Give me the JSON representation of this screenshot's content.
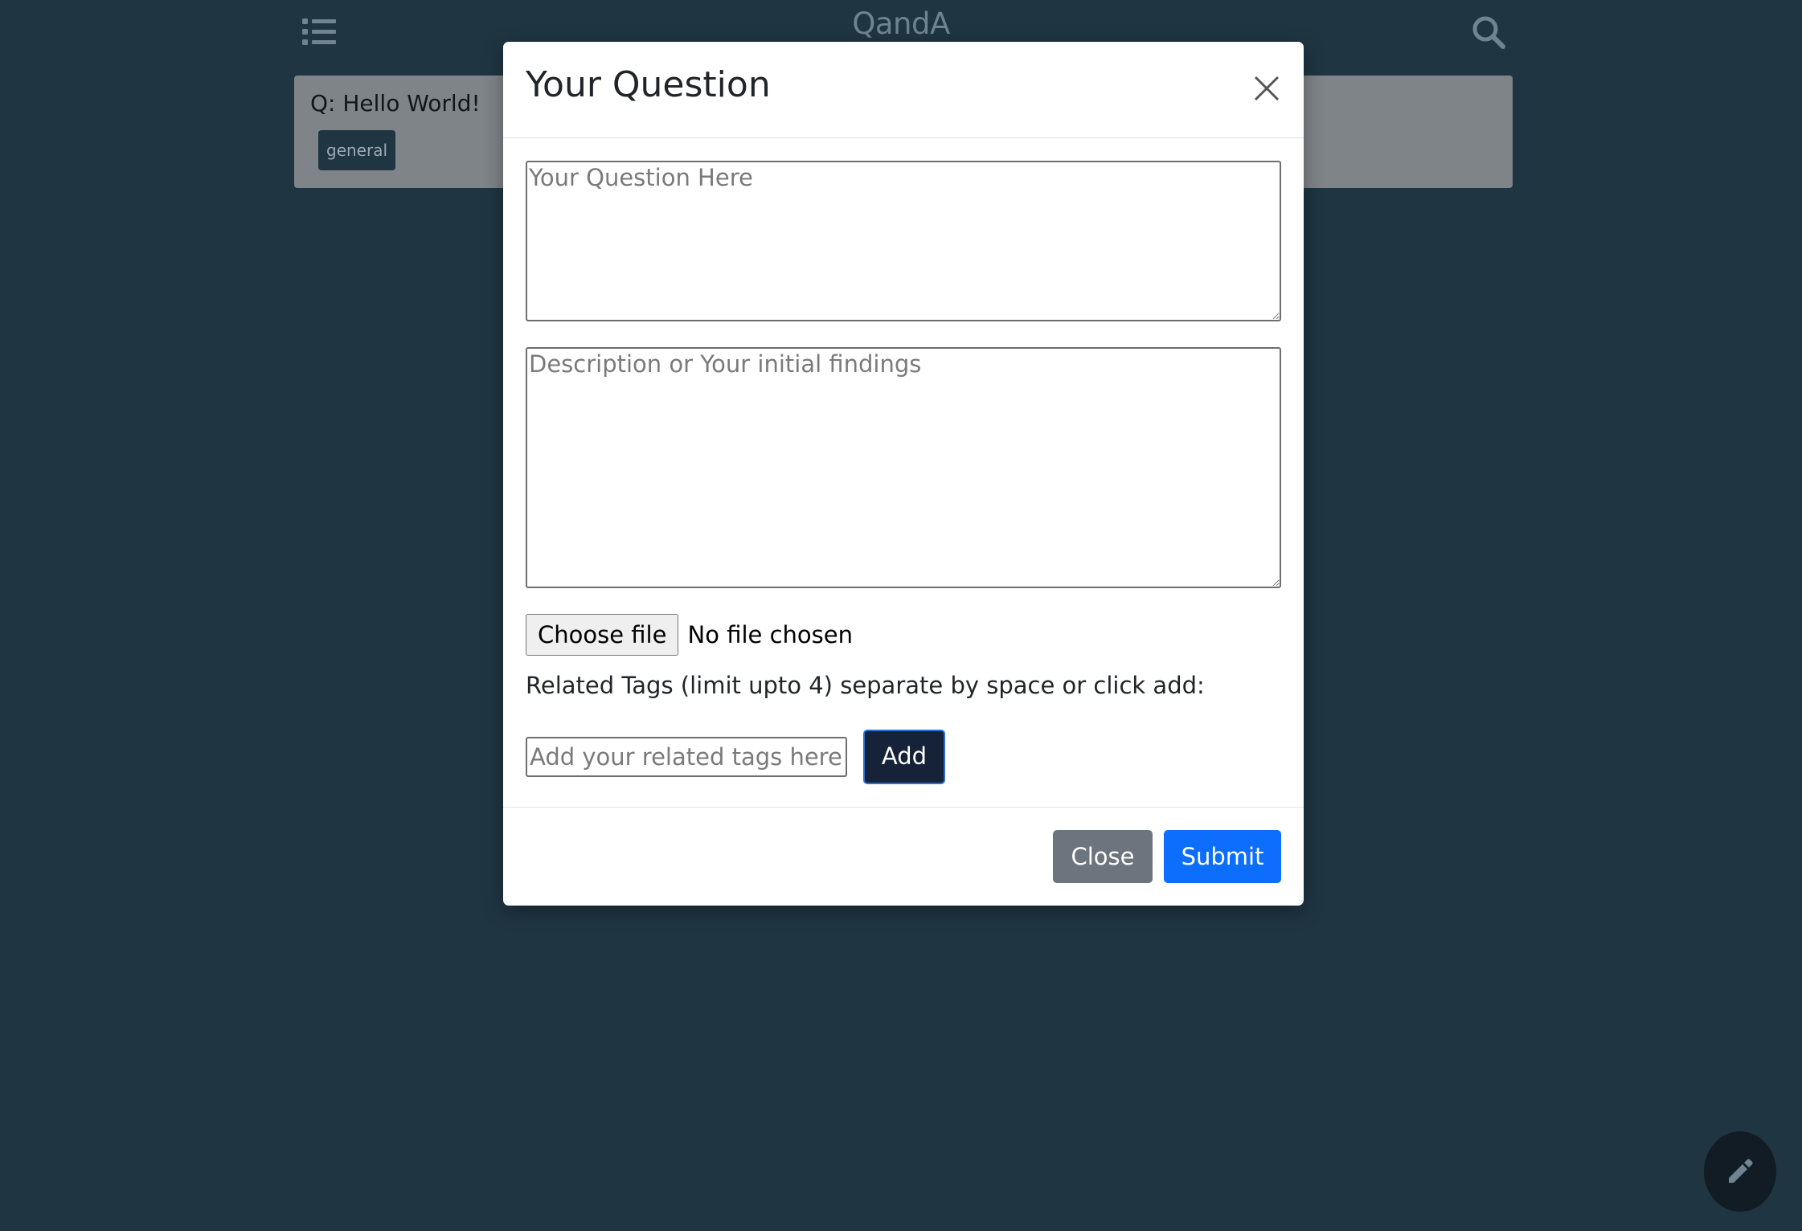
{
  "app": {
    "title": "QandA"
  },
  "question_card": {
    "title": "Q: Hello World!",
    "tag": "general"
  },
  "modal": {
    "title": "Your Question",
    "question_placeholder": "Your Question Here",
    "description_placeholder": "Description or Your initial findings",
    "choose_file_label": "Choose file",
    "file_status": "No file chosen",
    "tags_label": "Related Tags (limit upto 4) separate by space or click add:",
    "tags_placeholder": "Add your related tags here",
    "add_label": "Add",
    "close_label": "Close",
    "submit_label": "Submit"
  },
  "icons": {
    "menu": "list-icon",
    "search": "search-icon",
    "close": "close-icon",
    "fab": "pencil-icon"
  },
  "colors": {
    "background": "#1f3542",
    "card": "#7f8489",
    "tag_bg": "#1f3542",
    "add_button": "#152238",
    "close_button": "#6c757d",
    "submit_button": "#0d6efd",
    "fab": "#121c24"
  }
}
